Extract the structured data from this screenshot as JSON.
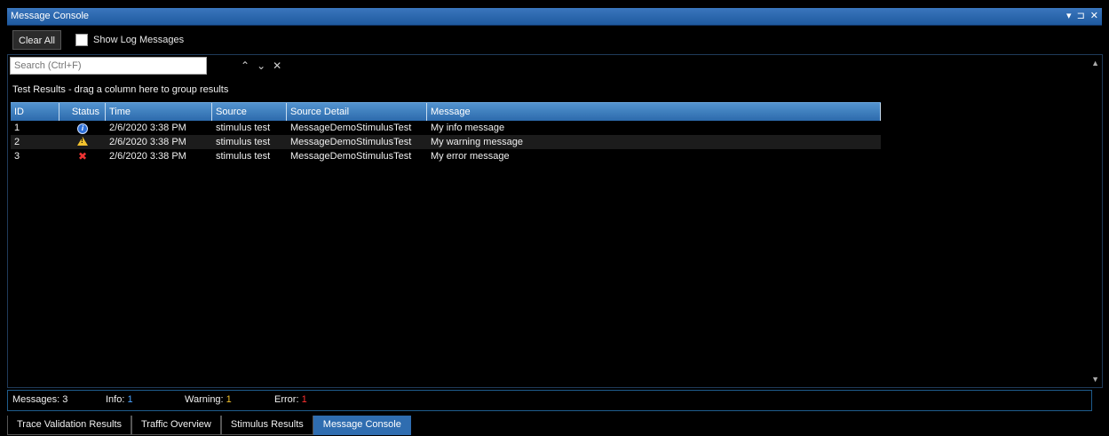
{
  "window": {
    "title": "Message Console",
    "controls": [
      "▾",
      "⊐",
      "✕"
    ]
  },
  "toolbar": {
    "clear_label": "Clear All",
    "show_log_label": "Show Log Messages",
    "show_log_checked": false
  },
  "search": {
    "placeholder": "Search (Ctrl+F)"
  },
  "grid": {
    "group_hint": "Test Results - drag a column here to group results",
    "columns": [
      "ID",
      "Status",
      "Time",
      "Source",
      "Source Detail",
      "Message"
    ],
    "rows": [
      {
        "id": "1",
        "status": "info-icon",
        "time": "2/6/2020 3:38 PM",
        "source": "stimulus test",
        "detail": "MessageDemoStimulusTest",
        "message": "My info message"
      },
      {
        "id": "2",
        "status": "warning-icon",
        "time": "2/6/2020 3:38 PM",
        "source": "stimulus test",
        "detail": "MessageDemoStimulusTest",
        "message": "My warning message"
      },
      {
        "id": "3",
        "status": "error-icon",
        "time": "2/6/2020 3:38 PM",
        "source": "stimulus test",
        "detail": "MessageDemoStimulusTest",
        "message": "My error message"
      }
    ]
  },
  "status": {
    "messages_label": "Messages:",
    "messages_value": "3",
    "info_label": "Info:",
    "info_value": "1",
    "warning_label": "Warning:",
    "warning_value": "1",
    "error_label": "Error:",
    "error_value": "1",
    "colors": {
      "info": "#4aa3ff",
      "warning": "#f2c12e",
      "error": "#ff3030"
    }
  },
  "tabs": [
    {
      "label": "Trace Validation Results",
      "active": false
    },
    {
      "label": "Traffic Overview",
      "active": false
    },
    {
      "label": "Stimulus Results",
      "active": false
    },
    {
      "label": "Message Console",
      "active": true
    }
  ]
}
